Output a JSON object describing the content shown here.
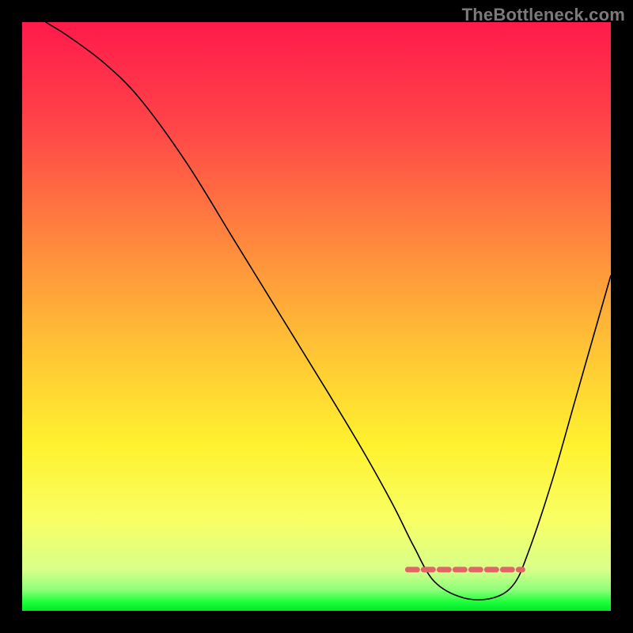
{
  "watermark": "TheBottleneck.com",
  "chart_data": {
    "type": "line",
    "title": "",
    "xlabel": "",
    "ylabel": "",
    "xlim": [
      0,
      100
    ],
    "ylim": [
      0,
      100
    ],
    "grid": false,
    "legend": false,
    "background_gradient": {
      "orientation": "vertical",
      "stops": [
        {
          "offset": 0.0,
          "color": "#ff1a4b"
        },
        {
          "offset": 0.18,
          "color": "#ff4648"
        },
        {
          "offset": 0.38,
          "color": "#ff8a3d"
        },
        {
          "offset": 0.55,
          "color": "#ffc235"
        },
        {
          "offset": 0.72,
          "color": "#fff22f"
        },
        {
          "offset": 0.85,
          "color": "#f8ff66"
        },
        {
          "offset": 0.93,
          "color": "#d8ff8a"
        },
        {
          "offset": 0.965,
          "color": "#8dff7a"
        },
        {
          "offset": 0.985,
          "color": "#1cff3a"
        },
        {
          "offset": 1.0,
          "color": "#00e828"
        }
      ]
    },
    "series": [
      {
        "name": "bottleneck-curve",
        "stroke": "#000000",
        "stroke_width": 1.6,
        "x": [
          4,
          8,
          14,
          20,
          28,
          36,
          44,
          52,
          58,
          63,
          66.5,
          70,
          75,
          80,
          83.5,
          86,
          90,
          94,
          98,
          100
        ],
        "y": [
          100,
          97.5,
          93,
          87,
          76,
          63,
          50,
          37,
          27,
          18,
          11,
          5,
          2.2,
          2.2,
          4.5,
          10,
          22,
          36,
          50,
          57
        ]
      }
    ],
    "annotations": [
      {
        "name": "optimal-band",
        "type": "segment",
        "stroke": "#e06666",
        "stroke_width": 7,
        "dash": [
          12,
          8
        ],
        "x1": 65.5,
        "y1": 7.0,
        "x2": 85.0,
        "y2": 7.0
      }
    ]
  }
}
